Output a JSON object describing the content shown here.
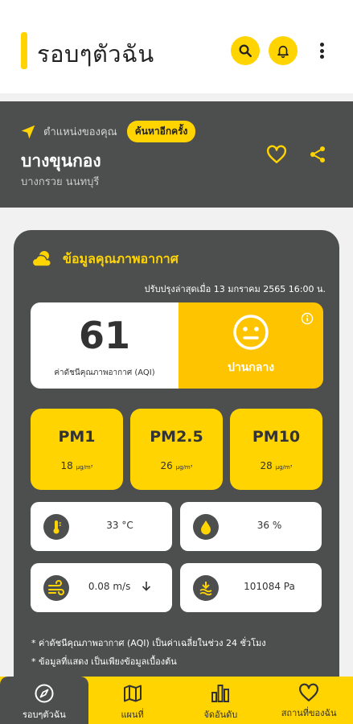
{
  "app": {
    "title": "รอบๆตัวฉัน"
  },
  "location": {
    "label": "ตำแหน่งของคุณ",
    "search_again": "ค้นหาอีกครั้ง",
    "name": "บางขุนกอง",
    "district": "บางกรวย นนทบุรี"
  },
  "air_quality": {
    "title": "ข้อมูลคุณภาพอากาศ",
    "updated": "ปรับปรุงล่าสุดเมื่อ 13 มกราคม 2565 16:00 น.",
    "aqi_value": "61",
    "aqi_caption": "ค่าดัชนีคุณภาพอากาศ (AQI)",
    "aqi_level": "ปานกลาง",
    "pm": [
      {
        "name": "PM1",
        "value": "18",
        "unit": "µg/m³"
      },
      {
        "name": "PM2.5",
        "value": "26",
        "unit": "µg/m³"
      },
      {
        "name": "PM10",
        "value": "28",
        "unit": "µg/m³"
      }
    ],
    "temperature": "33 °C",
    "humidity": "36 %",
    "wind": "0.08 m/s",
    "pressure": "101084 Pa",
    "notes": [
      "* ค่าดัชนีคุณภาพอากาศ (AQI) เป็นค่าเฉลี่ยในช่วง 24 ชั่วโมง",
      "* ข้อมูลที่แสดง เป็นเพียงข้อมูลเบื้องต้น"
    ]
  },
  "nav": [
    {
      "label": "รอบๆตัวฉัน",
      "icon": "compass-icon",
      "active": true
    },
    {
      "label": "แผนที่",
      "icon": "map-icon",
      "active": false
    },
    {
      "label": "จัดอันดับ",
      "icon": "ranking-icon",
      "active": false
    },
    {
      "label": "สถานที่ของฉัน",
      "icon": "heart-icon",
      "active": false
    }
  ],
  "colors": {
    "accent": "#FFD400",
    "dark": "#4d4f4f",
    "aqi_moderate": "#FFC400"
  }
}
